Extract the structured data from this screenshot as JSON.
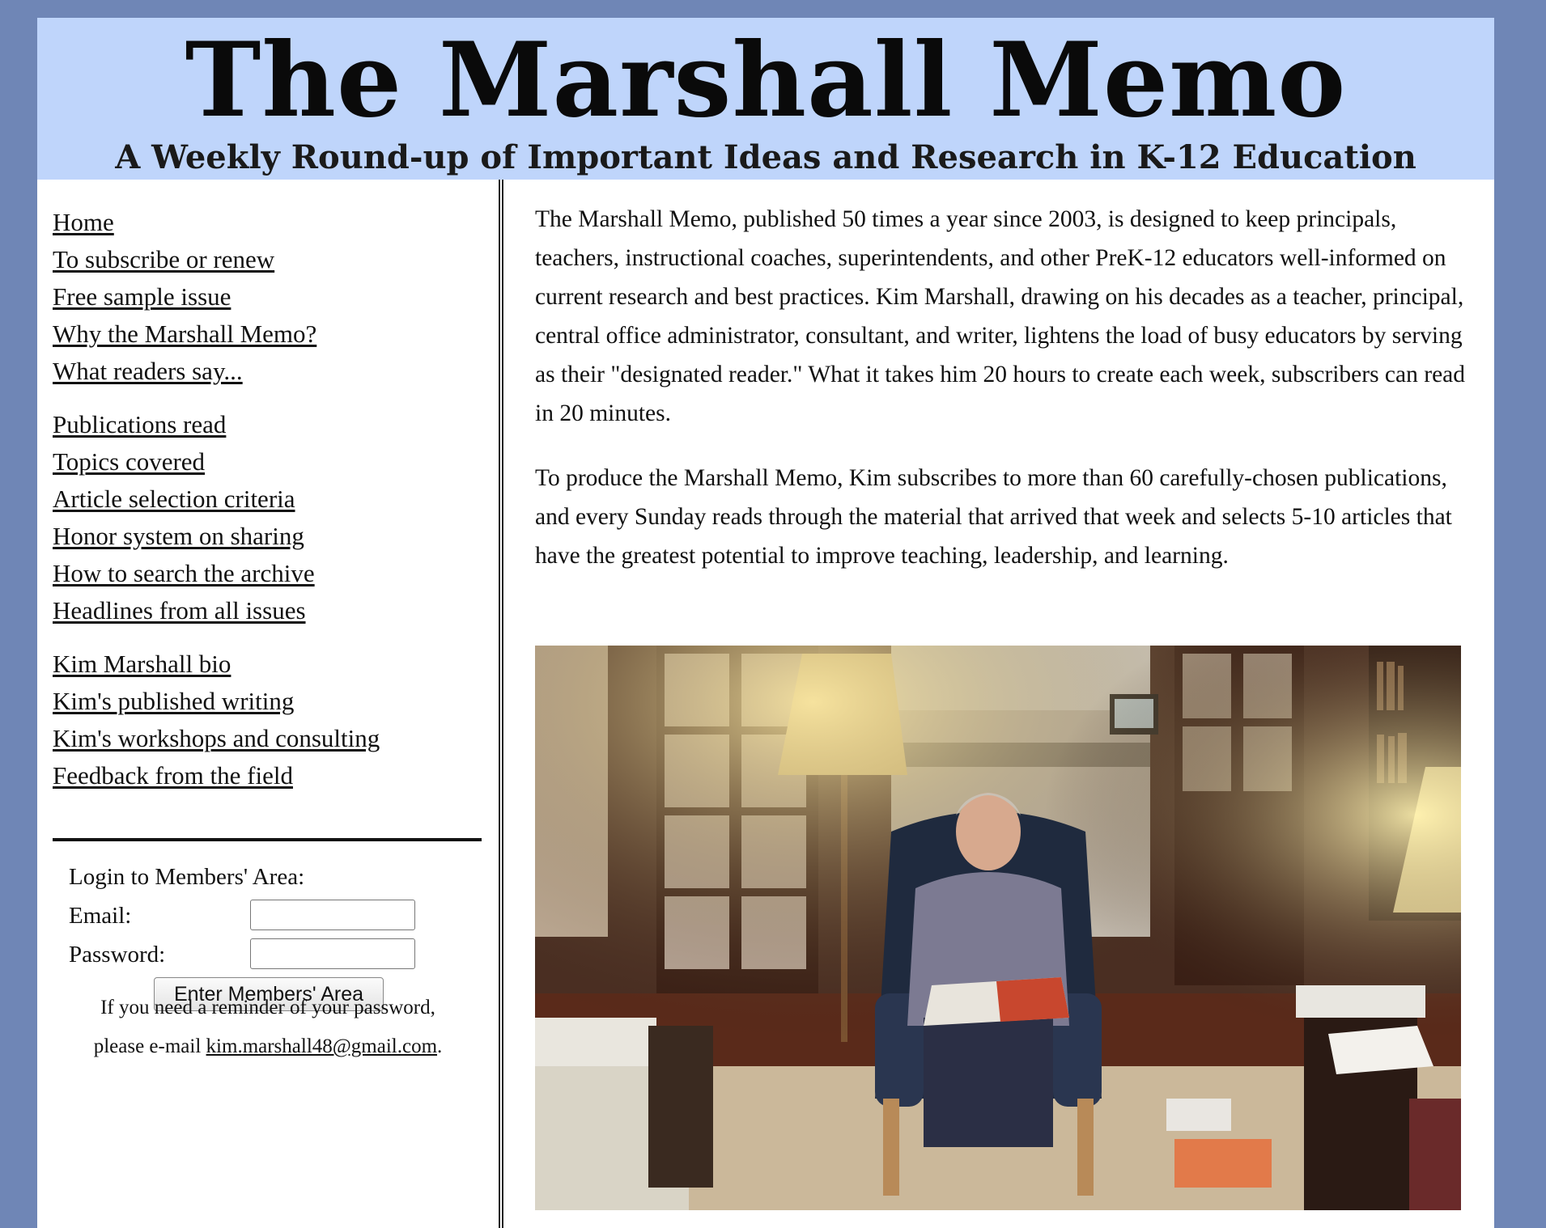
{
  "banner": {
    "title": "The Marshall Memo",
    "subtitle": "A Weekly Round-up of Important Ideas and Research in K-12 Education"
  },
  "sidebar": {
    "groups": [
      [
        {
          "label": "Home"
        },
        {
          "label": "To subscribe or renew"
        },
        {
          "label": "Free sample issue"
        },
        {
          "label": "Why the Marshall Memo?"
        },
        {
          "label": "What readers say..."
        }
      ],
      [
        {
          "label": "Publications read"
        },
        {
          "label": "Topics covered"
        },
        {
          "label": "Article selection criteria"
        },
        {
          "label": "Honor system on sharing"
        },
        {
          "label": "How to search the archive"
        },
        {
          "label": "Headlines from all issues"
        }
      ],
      [
        {
          "label": "Kim Marshall bio"
        },
        {
          "label": "Kim's published writing"
        },
        {
          "label": "Kim's workshops and consulting"
        },
        {
          "label": "Feedback from the field"
        }
      ]
    ],
    "login": {
      "heading": "Login to Members' Area:",
      "email_label": "Email:",
      "email_value": "",
      "password_label": "Password:",
      "password_value": "",
      "button_label": "Enter Members' Area"
    },
    "reminder": {
      "line1": "If you need a reminder of your password,",
      "line2_prefix": "please e-mail ",
      "email": "kim.marshall48@gmail.com",
      "line2_suffix": "."
    }
  },
  "main": {
    "paragraphs": [
      "The Marshall Memo, published 50 times a year since 2003, is designed to keep principals, teachers, instructional coaches, superintendents, and other PreK-12 educators well-informed on current research and best practices. Kim Marshall, drawing on his decades as a teacher, principal, central office administrator, consultant, and writer, lightens the load of busy educators by serving as their \"designated reader.\" What it takes him 20 hours to create each week, subscribers can read in 20 minutes.",
      "To produce the Marshall Memo, Kim subscribes to more than 60 carefully-chosen publications, and every Sunday reads through the material that arrived that week and selects 5-10 articles that have the greatest potential to improve teaching, leadership, and learning."
    ]
  },
  "colors": {
    "outer_background": "#6f86b6",
    "banner_background": "#bfd5fb",
    "page_background": "#ffffff"
  }
}
